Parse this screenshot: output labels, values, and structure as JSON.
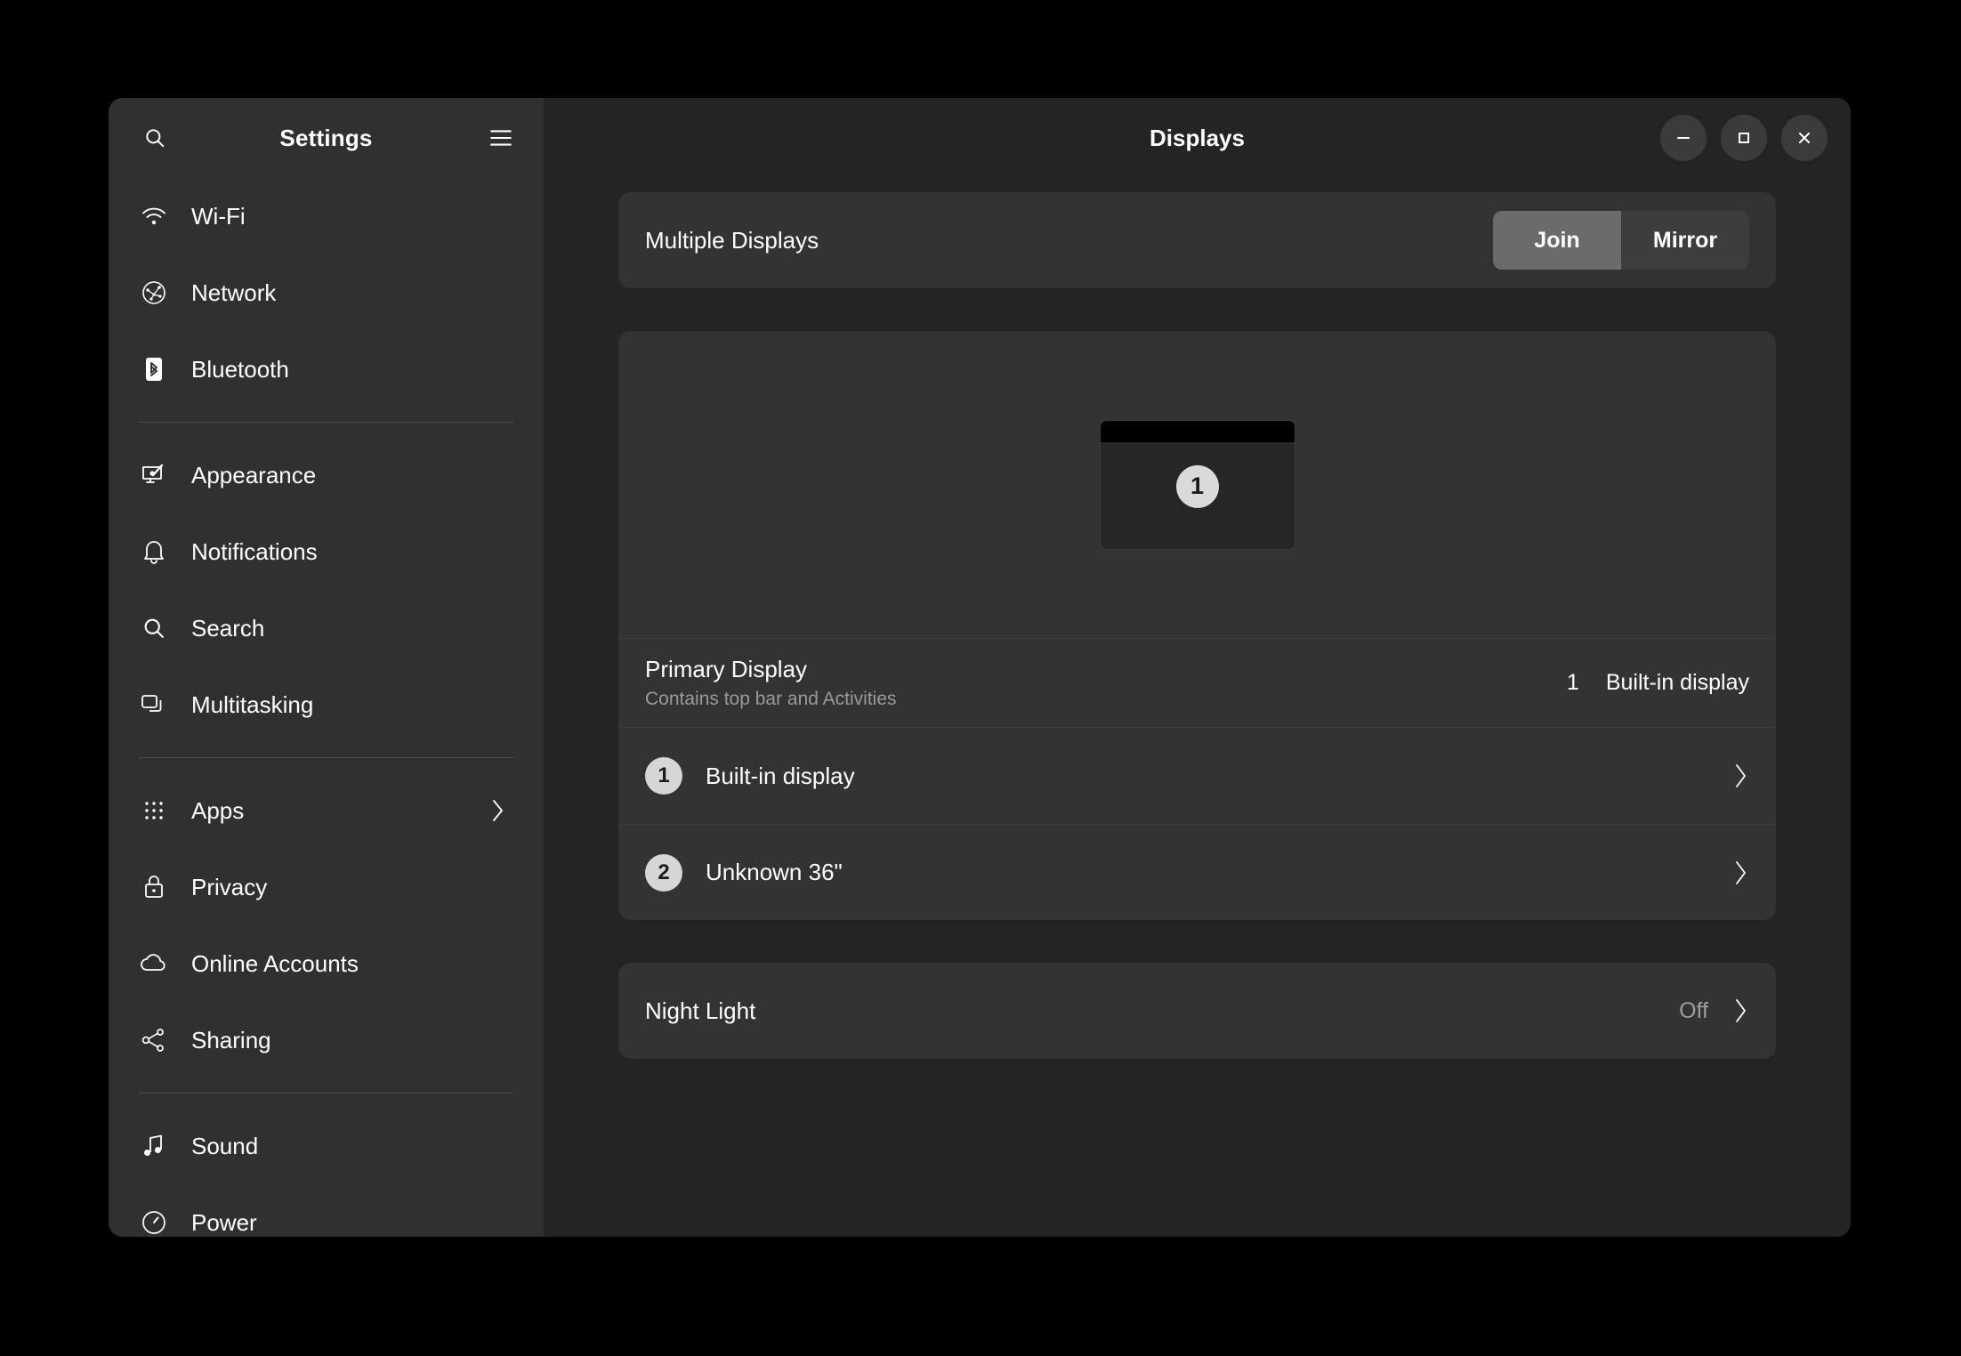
{
  "sidebar": {
    "title": "Settings",
    "search_icon": "search-icon",
    "menu_icon": "hamburger-menu-icon",
    "groups": [
      {
        "items": [
          {
            "label": "Wi-Fi",
            "icon": "wifi-icon"
          },
          {
            "label": "Network",
            "icon": "network-icon"
          },
          {
            "label": "Bluetooth",
            "icon": "bluetooth-icon"
          }
        ]
      },
      {
        "items": [
          {
            "label": "Appearance",
            "icon": "appearance-icon"
          },
          {
            "label": "Notifications",
            "icon": "bell-icon"
          },
          {
            "label": "Search",
            "icon": "search-icon"
          },
          {
            "label": "Multitasking",
            "icon": "multitasking-icon"
          }
        ]
      },
      {
        "items": [
          {
            "label": "Apps",
            "icon": "grid-apps-icon",
            "chevron": true
          },
          {
            "label": "Privacy",
            "icon": "lock-icon"
          },
          {
            "label": "Online Accounts",
            "icon": "cloud-icon"
          },
          {
            "label": "Sharing",
            "icon": "share-icon"
          }
        ]
      },
      {
        "items": [
          {
            "label": "Sound",
            "icon": "music-note-icon"
          },
          {
            "label": "Power",
            "icon": "power-icon"
          }
        ]
      }
    ]
  },
  "window": {
    "title": "Displays",
    "controls": {
      "minimize": "minimize-icon",
      "maximize": "maximize-icon",
      "close": "close-icon"
    }
  },
  "main": {
    "multiple_displays": {
      "label": "Multiple Displays",
      "options": [
        "Join",
        "Mirror"
      ],
      "selected": "Join"
    },
    "arrangement": {
      "monitor_badge": "1"
    },
    "primary_display": {
      "title": "Primary Display",
      "subtitle": "Contains top bar and Activities",
      "value_number": "1",
      "value_name": "Built-in display"
    },
    "displays": [
      {
        "number": "1",
        "name": "Built-in display"
      },
      {
        "number": "2",
        "name": "Unknown 36\""
      }
    ],
    "night_light": {
      "label": "Night Light",
      "value": "Off"
    }
  },
  "colors": {
    "window_bg": "#242424",
    "sidebar_bg": "#303030",
    "card_bg": "#333333",
    "segment_active": "#6b6b6b",
    "segment_inactive": "#3d3d3d",
    "badge_bg": "#d6d6d6",
    "muted_text": "#9a9a9a"
  }
}
